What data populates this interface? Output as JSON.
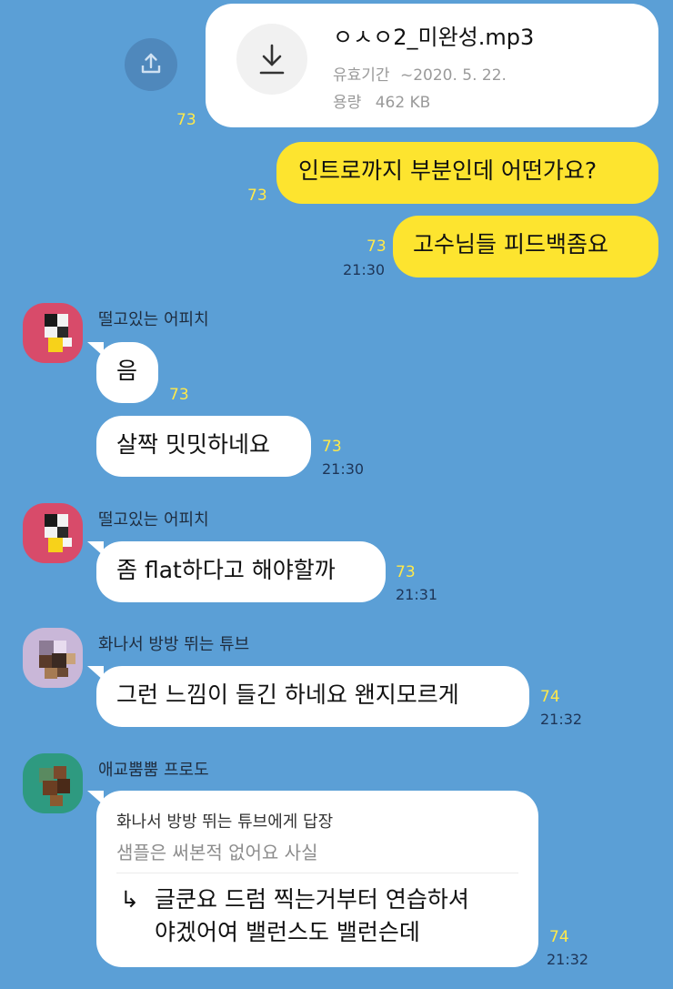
{
  "file_message": {
    "share_icon": "share-icon",
    "download_icon": "download-icon",
    "filename": "ㅇㅅㅇ2_미완성.mp3",
    "expiry_label": "유효기간",
    "expiry_value": "~2020. 5. 22.",
    "size_label": "용량",
    "size_value": "462 KB",
    "unread": "73"
  },
  "my_messages": [
    {
      "text": "인트로까지 부분인데 어떤가요?",
      "unread": "73",
      "time": ""
    },
    {
      "text": "고수님들 피드백좀요",
      "unread": "73",
      "time": "21:30"
    }
  ],
  "groups": [
    {
      "name": "떨고있는 어피치",
      "messages": [
        {
          "text": "음",
          "unread": "73",
          "time": ""
        },
        {
          "text": "살짝 밋밋하네요",
          "unread": "73",
          "time": "21:30"
        }
      ]
    },
    {
      "name": "떨고있는 어피치",
      "messages": [
        {
          "text": "좀 flat하다고 해야할까",
          "unread": "73",
          "time": "21:31"
        }
      ]
    },
    {
      "name": "화나서 방방 뛰는 튜브",
      "messages": [
        {
          "text": "그런 느낌이 들긴 하네요 왠지모르게",
          "unread": "74",
          "time": "21:32"
        }
      ]
    },
    {
      "name": "애교뿜뿜 프로도",
      "reply": {
        "to": "화나서 방방 뛰는 튜브에게 답장",
        "quote": "샘플은 써본적 없어요 사실",
        "arrow": "↳",
        "line1": "글쿤요 드럼 찍는거부터 연습하셔",
        "line2": "야겠어여 밸런스도 밸런슨데",
        "unread": "74",
        "time": "21:32"
      }
    }
  ]
}
